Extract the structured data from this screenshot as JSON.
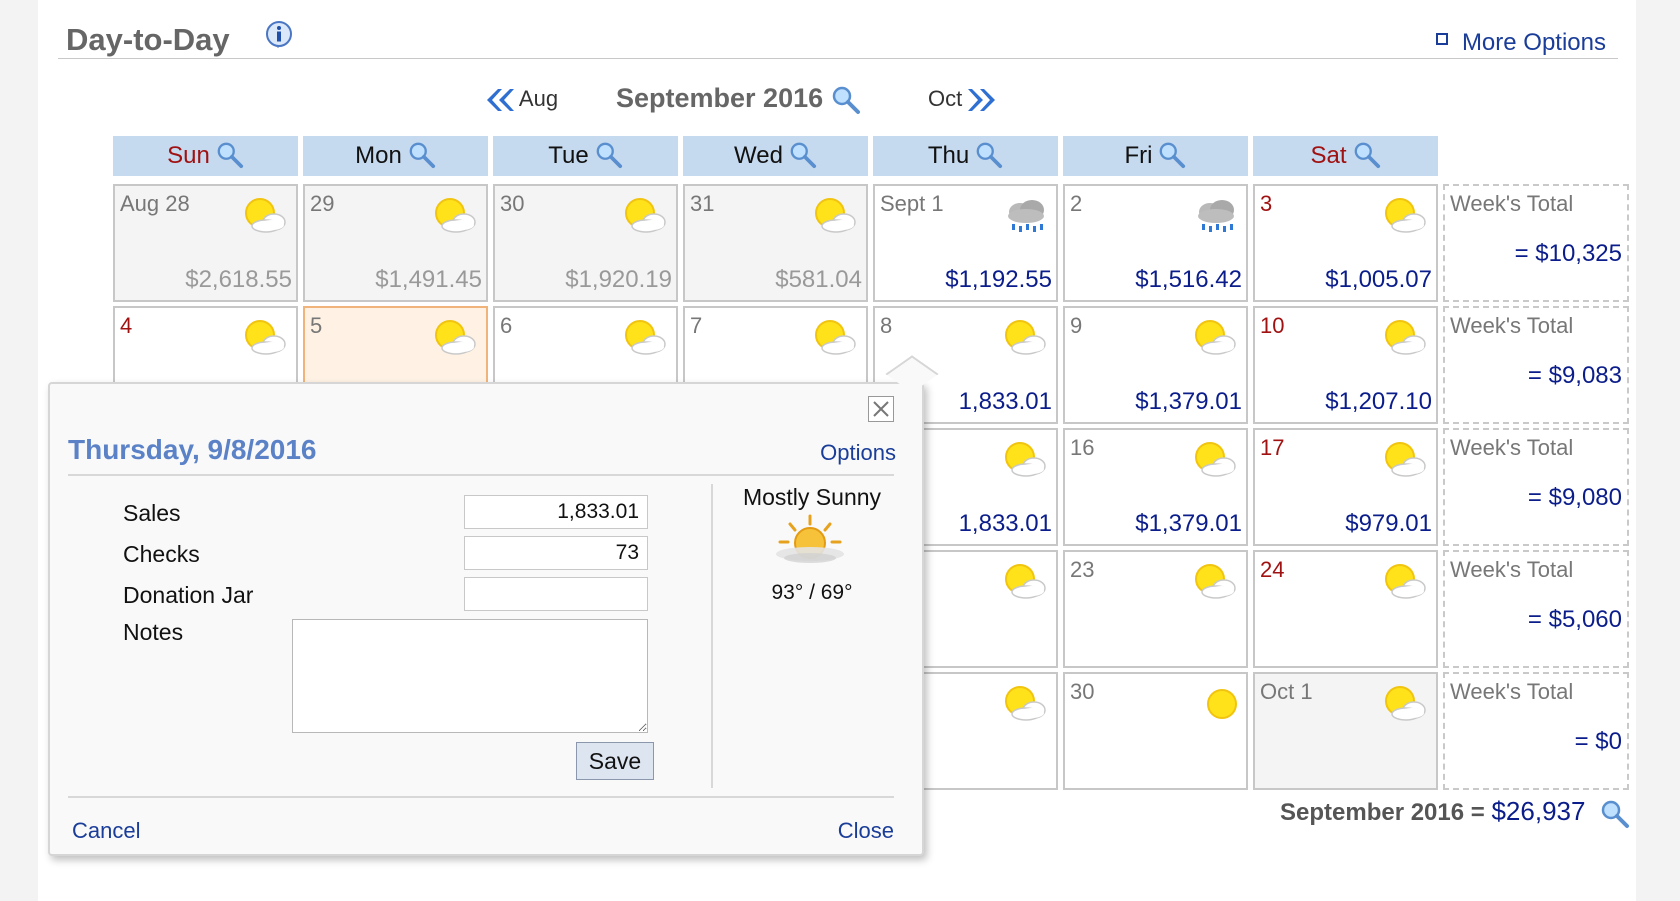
{
  "header": {
    "title": "Day-to-Day",
    "more_options": "More Options"
  },
  "nav": {
    "prev_label": "Aug",
    "month_title": "September 2016",
    "next_label": "Oct"
  },
  "days_of_week": [
    "Sun",
    "Mon",
    "Tue",
    "Wed",
    "Thu",
    "Fri",
    "Sat"
  ],
  "weeks": [
    {
      "days": [
        {
          "label": "Aug 28",
          "amount": "$2,618.55",
          "weather": "partly-cloudy-icon",
          "other": true
        },
        {
          "label": "29",
          "amount": "$1,491.45",
          "weather": "partly-cloudy-icon",
          "other": true
        },
        {
          "label": "30",
          "amount": "$1,920.19",
          "weather": "partly-cloudy-icon",
          "other": true
        },
        {
          "label": "31",
          "amount": "$581.04",
          "weather": "partly-cloudy-icon",
          "other": true
        },
        {
          "label": "Sept 1",
          "amount": "$1,192.55",
          "weather": "rain-icon",
          "other": false
        },
        {
          "label": "2",
          "amount": "$1,516.42",
          "weather": "rain-icon",
          "other": false
        },
        {
          "label": "3",
          "amount": "$1,005.07",
          "weather": "partly-cloudy-icon",
          "other": false
        }
      ],
      "total_label": "Week's Total",
      "total": "= $10,325"
    },
    {
      "days": [
        {
          "label": "4",
          "amount": "",
          "weather": "partly-cloudy-icon",
          "other": false
        },
        {
          "label": "5",
          "amount": "",
          "weather": "partly-cloudy-icon",
          "other": false,
          "today": true
        },
        {
          "label": "6",
          "amount": "",
          "weather": "partly-cloudy-icon",
          "other": false
        },
        {
          "label": "7",
          "amount": "",
          "weather": "partly-cloudy-icon",
          "other": false
        },
        {
          "label": "8",
          "amount": "1,833.01",
          "weather": "partly-cloudy-icon",
          "other": false
        },
        {
          "label": "9",
          "amount": "$1,379.01",
          "weather": "partly-cloudy-icon",
          "other": false
        },
        {
          "label": "10",
          "amount": "$1,207.10",
          "weather": "partly-cloudy-icon",
          "other": false
        }
      ],
      "total_label": "Week's Total",
      "total": "= $9,083"
    },
    {
      "days": [
        {
          "label": "",
          "amount": "",
          "weather": "",
          "other": false
        },
        {
          "label": "",
          "amount": "",
          "weather": "",
          "other": false
        },
        {
          "label": "",
          "amount": "",
          "weather": "",
          "other": false
        },
        {
          "label": "",
          "amount": "",
          "weather": "",
          "other": false
        },
        {
          "label": "",
          "amount": "1,833.01",
          "weather": "partly-cloudy-icon",
          "other": false
        },
        {
          "label": "16",
          "amount": "$1,379.01",
          "weather": "partly-cloudy-icon",
          "other": false
        },
        {
          "label": "17",
          "amount": "$979.01",
          "weather": "partly-cloudy-icon",
          "other": false
        }
      ],
      "total_label": "Week's Total",
      "total": "= $9,080"
    },
    {
      "days": [
        {
          "label": "",
          "amount": "",
          "weather": "",
          "other": false
        },
        {
          "label": "",
          "amount": "",
          "weather": "",
          "other": false
        },
        {
          "label": "",
          "amount": "",
          "weather": "",
          "other": false
        },
        {
          "label": "",
          "amount": "",
          "weather": "",
          "other": false
        },
        {
          "label": "",
          "amount": "",
          "weather": "partly-cloudy-icon",
          "other": false
        },
        {
          "label": "23",
          "amount": "",
          "weather": "partly-cloudy-icon",
          "other": false
        },
        {
          "label": "24",
          "amount": "",
          "weather": "partly-cloudy-icon",
          "other": false
        }
      ],
      "total_label": "Week's Total",
      "total": "= $5,060"
    },
    {
      "days": [
        {
          "label": "",
          "amount": "",
          "weather": "",
          "other": false
        },
        {
          "label": "",
          "amount": "",
          "weather": "",
          "other": false
        },
        {
          "label": "",
          "amount": "",
          "weather": "",
          "other": false
        },
        {
          "label": "",
          "amount": "",
          "weather": "",
          "other": false
        },
        {
          "label": "",
          "amount": "",
          "weather": "partly-cloudy-icon",
          "other": false
        },
        {
          "label": "30",
          "amount": "",
          "weather": "sunny-icon",
          "other": false
        },
        {
          "label": "Oct 1",
          "amount": "",
          "weather": "partly-cloudy-icon",
          "other": true
        }
      ],
      "total_label": "Week's Total",
      "total": "= $0"
    }
  ],
  "month_total": {
    "label": "September 2016 =",
    "value": "$26,937"
  },
  "popup": {
    "title": "Thursday, 9/8/2016",
    "options": "Options",
    "fields": {
      "sales_label": "Sales",
      "sales_value": "1,833.01",
      "checks_label": "Checks",
      "checks_value": "73",
      "donation_label": "Donation Jar",
      "donation_value": "",
      "notes_label": "Notes",
      "notes_value": ""
    },
    "save": "Save",
    "weather": {
      "condition": "Mostly Sunny",
      "temps": "93° / 69°"
    },
    "cancel": "Cancel",
    "close": "Close"
  },
  "colors": {
    "link": "#1a3d99",
    "amount": "#0b1d8a",
    "weekend": "#a01212",
    "header_bg": "#c5d9ef",
    "popup_title": "#5b82c7"
  }
}
